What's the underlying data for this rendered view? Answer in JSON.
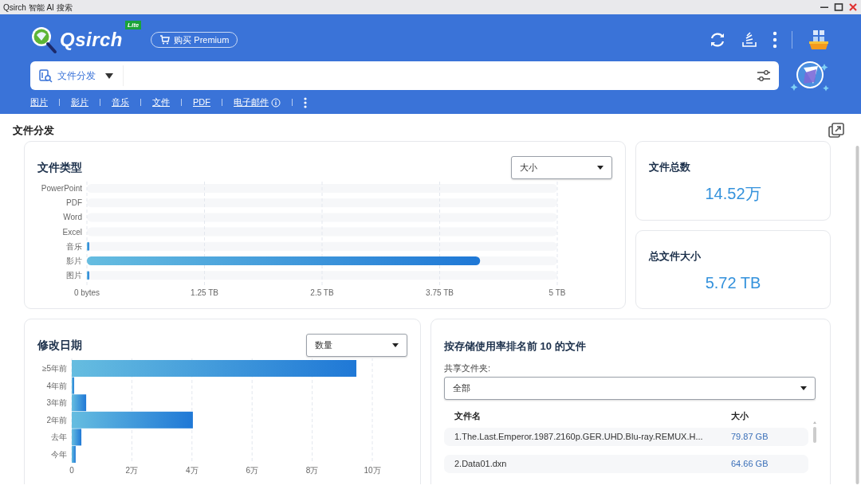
{
  "window": {
    "title": "Qsirch 智能 AI 搜索"
  },
  "header": {
    "logo_text": "Qsirch",
    "badge": "Lite",
    "premium_button": "购买 Premium"
  },
  "search": {
    "scope": "文件分发"
  },
  "categories": [
    {
      "label": "图片"
    },
    {
      "label": "影片"
    },
    {
      "label": "音乐"
    },
    {
      "label": "文件"
    },
    {
      "label": "PDF"
    },
    {
      "label": "电子邮件",
      "info": true
    }
  ],
  "page_title": "文件分发",
  "file_types": {
    "title": "文件类型",
    "sort": "大小",
    "chart_data": {
      "type": "bar",
      "orientation": "horizontal",
      "categories": [
        "PowerPoint",
        "PDF",
        "Word",
        "Excel",
        "音乐",
        "影片",
        "图片"
      ],
      "values": [
        0,
        0,
        0,
        0,
        0.02,
        4.18,
        0.01
      ],
      "xlim": [
        0,
        5
      ],
      "grid": true,
      "xticks": [
        {
          "value": 0,
          "label": "0 bytes"
        },
        {
          "value": 1.25,
          "label": "1.25 TB"
        },
        {
          "value": 2.5,
          "label": "2.5 TB"
        },
        {
          "value": 3.75,
          "label": "3.75 TB"
        },
        {
          "value": 5,
          "label": "5 TB"
        }
      ]
    }
  },
  "stats": [
    {
      "label": "文件总数",
      "value": "14.52万"
    },
    {
      "label": "总文件大小",
      "value": "5.72 TB"
    }
  ],
  "modified": {
    "title": "修改日期",
    "sort": "数量",
    "chart_data": {
      "type": "bar",
      "orientation": "horizontal",
      "categories": [
        "≥5年前",
        "4年前",
        "3年前",
        "2年前",
        "去年",
        "今年"
      ],
      "values": [
        9.47,
        0.08,
        0.48,
        4.03,
        0.32,
        0.13
      ],
      "xlim": [
        0,
        10
      ],
      "grid": true,
      "xticks": [
        {
          "value": 0,
          "label": "0"
        },
        {
          "value": 2,
          "label": "2万"
        },
        {
          "value": 4,
          "label": "4万"
        },
        {
          "value": 6,
          "label": "6万"
        },
        {
          "value": 8,
          "label": "8万"
        },
        {
          "value": 10,
          "label": "10万"
        }
      ]
    }
  },
  "top_files": {
    "title": "按存储使用率排名前 10 的文件",
    "folder_label": "共享文件夹:",
    "folder": "全部",
    "columns": [
      "文件名",
      "大小"
    ],
    "rows": [
      {
        "name": "1.The.Last.Emperor.1987.2160p.GER.UHD.Blu-ray.REMUX.H...",
        "size": "79.87 GB"
      },
      {
        "name": "2.Data01.dxn",
        "size": "64.66 GB"
      }
    ]
  }
}
